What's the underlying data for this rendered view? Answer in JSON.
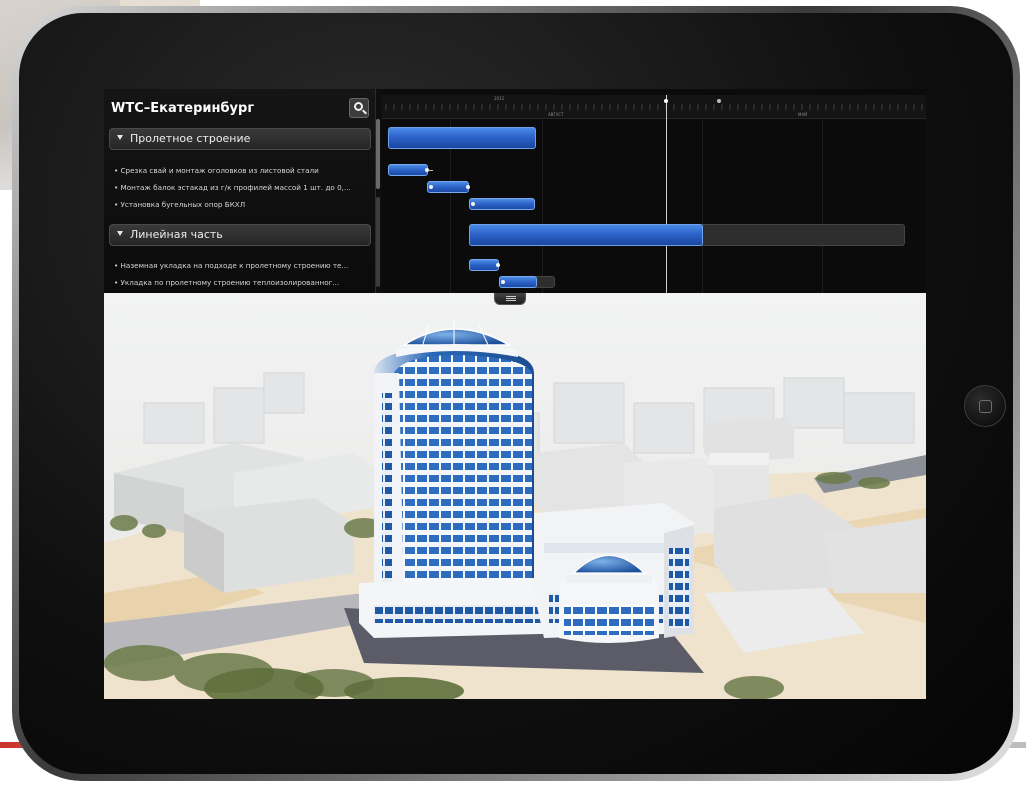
{
  "project": {
    "title": "WTC–Екатеринбург",
    "search_icon": "search-icon"
  },
  "tasks": {
    "groups": [
      {
        "label": "Пролетное строение",
        "items": [
          "• Срезка свай и монтаж оголовков из листовой стали",
          "• Монтаж балок эстакад из г/к профилей массой 1 шт. до 0,...",
          "• Установка бугельных опор БКХЛ"
        ]
      },
      {
        "label": "Линейная часть",
        "items": [
          "• Наземная укладка на подходе к пролетному строению те...",
          "• Укладка по пролетному строению теплоизолированног..."
        ]
      }
    ]
  },
  "timeline": {
    "year": "2012",
    "months": [
      "АВГУСТ",
      "МАЙ"
    ]
  },
  "gantt": {
    "group_progress": [
      {
        "name": "Пролетное строение",
        "progress": 1.0
      },
      {
        "name": "Линейная часть",
        "progress": 0.5
      }
    ]
  },
  "colors": {
    "bar_blue": "#2c65c9",
    "panel_bg": "#0e0e0e",
    "group_header": "#2f2f2f"
  },
  "view": {
    "handle_icon": "menu-handle-icon"
  }
}
